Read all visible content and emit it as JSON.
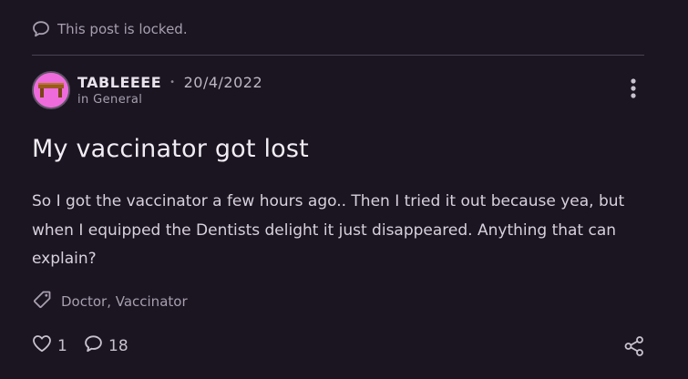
{
  "locked_notice": {
    "text": "This post is locked.",
    "icon": "speech-bubble-icon"
  },
  "post": {
    "author": "TABLEEEE",
    "separator": "•",
    "date": "20/4/2022",
    "category": "in General",
    "title": "My vaccinator got lost",
    "body": "So I got the vaccinator a few hours ago.. Then I tried it out because yea, but when I equipped the Dentists delight it just disappeared. Anything that can explain?",
    "tags": "Doctor, Vaccinator",
    "likes": "1",
    "comments": "18"
  },
  "icons": {
    "more": "vertical-dots-icon",
    "tag": "tag-icon",
    "like": "heart-icon",
    "comment": "comment-icon",
    "share": "share-icon"
  },
  "colors": {
    "background": "#1b1421",
    "avatar_background": "#ee6bdc",
    "avatar_table": "#9a5a1c",
    "text_primary": "#f1edf4",
    "text_muted": "#a79fae",
    "divider": "#4a4252"
  }
}
